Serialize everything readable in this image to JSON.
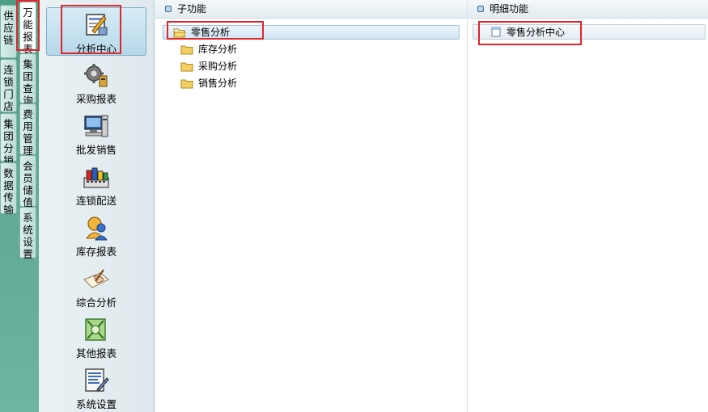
{
  "tabs_column1": [
    {
      "label": "供应链"
    },
    {
      "label": "连锁门店"
    },
    {
      "label": "集团分销"
    },
    {
      "label": "数据传输"
    }
  ],
  "tabs_column2": [
    {
      "label": "万能报表",
      "active": true
    },
    {
      "label": "集团查询"
    },
    {
      "label": "费用管理"
    },
    {
      "label": "会员储值"
    },
    {
      "label": "系统设置"
    }
  ],
  "sidebar": {
    "items": [
      {
        "label": "分析中心",
        "icon": "analysis-center-icon",
        "selected": true
      },
      {
        "label": "采购报表",
        "icon": "gear-report-icon"
      },
      {
        "label": "批发销售",
        "icon": "computer-sales-icon"
      },
      {
        "label": "连锁配送",
        "icon": "paint-delivery-icon"
      },
      {
        "label": "库存报表",
        "icon": "person-inventory-icon"
      },
      {
        "label": "综合分析",
        "icon": "hand-writing-icon"
      },
      {
        "label": "其他报表",
        "icon": "money-report-icon"
      },
      {
        "label": "系统设置",
        "icon": "settings-sheet-icon"
      }
    ]
  },
  "subfunction": {
    "header": "子功能",
    "items": [
      {
        "label": "零售分析",
        "selected": true
      },
      {
        "label": "库存分析"
      },
      {
        "label": "采购分析"
      },
      {
        "label": "销售分析"
      }
    ]
  },
  "detail": {
    "header": "明细功能",
    "items": [
      {
        "label": "零售分析中心"
      }
    ]
  },
  "colors": {
    "highlight": "#e0252b",
    "backdrop": "#5fa893",
    "folder": "#f2cf63"
  }
}
